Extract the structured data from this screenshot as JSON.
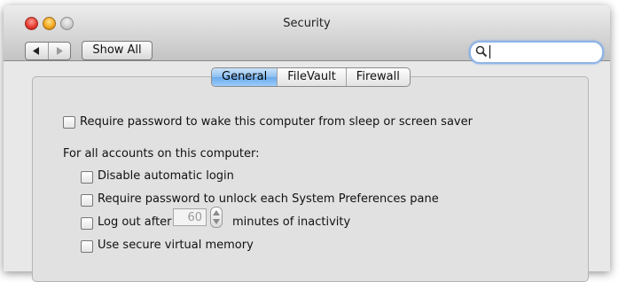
{
  "window": {
    "title": "Security"
  },
  "toolbar": {
    "back_icon": "triangle-left-icon",
    "forward_icon": "triangle-right-icon",
    "show_all_label": "Show All",
    "search_value": ""
  },
  "tabs": [
    {
      "label": "General",
      "active": true
    },
    {
      "label": "FileVault",
      "active": false
    },
    {
      "label": "Firewall",
      "active": false
    }
  ],
  "general": {
    "require_password_wake": {
      "label": "Require password to wake this computer from sleep or screen saver",
      "checked": false
    },
    "accounts_heading": "For all accounts on this computer:",
    "options": [
      {
        "label": "Disable automatic login",
        "checked": false
      },
      {
        "label": "Require password to unlock each System Preferences pane",
        "checked": false
      },
      {
        "label": "Log out after",
        "checked": false
      },
      {
        "label": "Use secure virtual memory",
        "checked": false
      }
    ],
    "logout_minutes": "60",
    "logout_suffix": "minutes of inactivity"
  },
  "colors": {
    "active_tab": "#8cc0f1",
    "search_focus": "#8fb4e6"
  }
}
